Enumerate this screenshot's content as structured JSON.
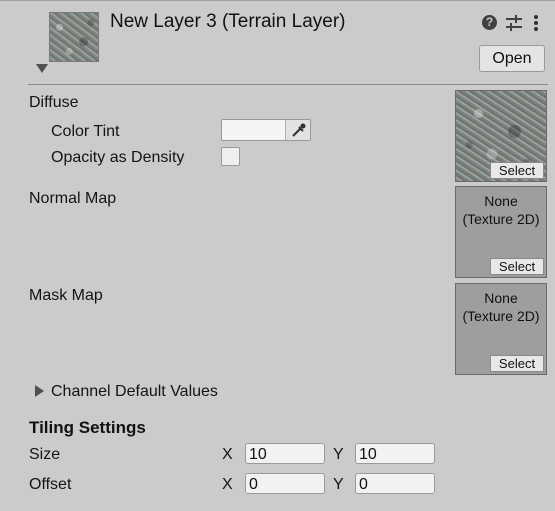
{
  "header": {
    "title": "New Layer 3 (Terrain Layer)",
    "help_icon": "help-icon",
    "presets_icon": "presets-icon",
    "menu_icon": "kebab-menu-icon",
    "open_label": "Open"
  },
  "diffuse": {
    "label": "Diffuse",
    "color_tint_label": "Color Tint",
    "color_tint_value": "#f4f4f4",
    "opacity_label": "Opacity as Density",
    "opacity_checked": false,
    "select_label": "Select"
  },
  "normal_map": {
    "label": "Normal Map",
    "texture_line1": "None",
    "texture_line2": "(Texture 2D)",
    "select_label": "Select"
  },
  "mask_map": {
    "label": "Mask Map",
    "texture_line1": "None",
    "texture_line2": "(Texture 2D)",
    "select_label": "Select"
  },
  "channel_defaults": {
    "label": "Channel Default Values",
    "expanded": false
  },
  "tiling": {
    "heading": "Tiling Settings",
    "size": {
      "label": "Size",
      "x_label": "X",
      "x_value": "10",
      "y_label": "Y",
      "y_value": "10"
    },
    "offset": {
      "label": "Offset",
      "x_label": "X",
      "x_value": "0",
      "y_label": "Y",
      "y_value": "0"
    }
  }
}
